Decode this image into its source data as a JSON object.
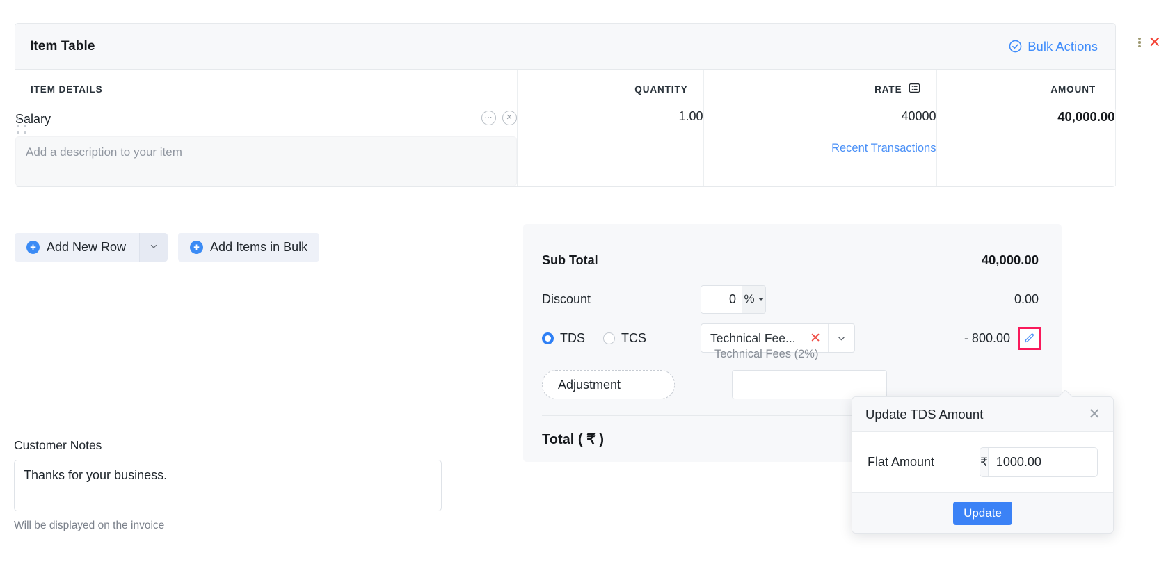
{
  "item_table": {
    "title": "Item Table",
    "bulk_actions_label": "Bulk Actions",
    "columns": {
      "details": "ITEM DETAILS",
      "quantity": "QUANTITY",
      "rate": "RATE",
      "amount": "AMOUNT"
    },
    "rows": [
      {
        "name": "Salary",
        "description_placeholder": "Add a description to your item",
        "quantity": "1.00",
        "rate": "40000",
        "amount": "40,000.00",
        "recent_transactions_label": "Recent Transactions"
      }
    ]
  },
  "actions": {
    "add_new_row": "Add New Row",
    "add_items_in_bulk": "Add Items in Bulk"
  },
  "notes": {
    "label": "Customer Notes",
    "value": "Thanks for your business.",
    "hint": "Will be displayed on the invoice"
  },
  "totals": {
    "sub_total_label": "Sub Total",
    "sub_total_value": "40,000.00",
    "discount_label": "Discount",
    "discount_value": "0",
    "discount_unit": "%",
    "discount_amount": "0.00",
    "tds_label": "TDS",
    "tcs_label": "TCS",
    "tax_selected": "Technical Fee...",
    "tax_sub_label": "Technical Fees (2%)",
    "tds_amount": "- 800.00",
    "adjustment_label": "Adjustment",
    "adjustment_value": "",
    "total_label": "Total ( ₹ )"
  },
  "popover": {
    "title": "Update TDS Amount",
    "field_label": "Flat Amount",
    "currency_symbol": "₹",
    "amount_value": "1000.00",
    "update_label": "Update"
  },
  "colors": {
    "accent_blue": "#3b82f6",
    "link_blue": "#408dfb",
    "highlight_pink": "#f91a5b",
    "danger_red": "#f44336"
  }
}
